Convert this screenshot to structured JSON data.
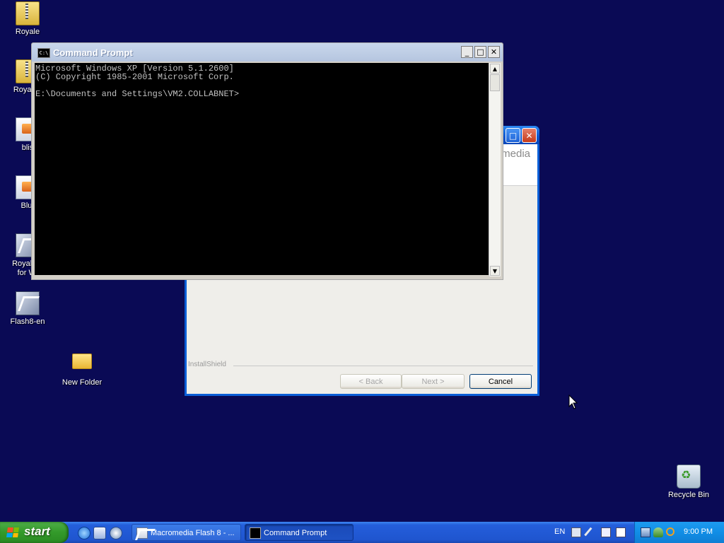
{
  "desktop": {
    "icons": [
      {
        "label": "Royale",
        "kind": "zip-icon"
      },
      {
        "label": "Royale_",
        "kind": "zip-icon"
      },
      {
        "label": "blis",
        "kind": "installer-icon"
      },
      {
        "label": "Bluf",
        "kind": "installer-icon"
      },
      {
        "label": "Royale T",
        "label2": "for Wi",
        "kind": "flash-installer-icon"
      },
      {
        "label": "Flash8-en",
        "kind": "flash-installer-icon"
      },
      {
        "label": "New Folder",
        "kind": "folder-icon"
      },
      {
        "label": "Recycle Bin",
        "kind": "recycle-bin-icon"
      }
    ]
  },
  "installer": {
    "brand_text": "media",
    "installshield_label": "InstallShield",
    "back_label": "< Back",
    "next_label": "Next >",
    "cancel_label": "Cancel"
  },
  "cmd": {
    "title": "Command Prompt",
    "icon_text": "C:\\",
    "console_lines": [
      "Microsoft Windows XP [Version 5.1.2600]",
      "(C) Copyright 1985-2001 Microsoft Corp.",
      "",
      "E:\\Documents and Settings\\VM2.COLLABNET>"
    ],
    "minimize_glyph": "_",
    "maximize_glyph": "□",
    "close_glyph": "✕"
  },
  "taskbar": {
    "start_label": "start",
    "tasks": [
      {
        "label": "Macromedia Flash 8 - ...",
        "active": false
      },
      {
        "label": "Command Prompt",
        "active": true
      }
    ],
    "language": "EN",
    "clock": "9:00 PM"
  },
  "colors": {
    "desktop": "#0a0a55",
    "taskbar": "#245edb",
    "start_green": "#339a2a"
  }
}
